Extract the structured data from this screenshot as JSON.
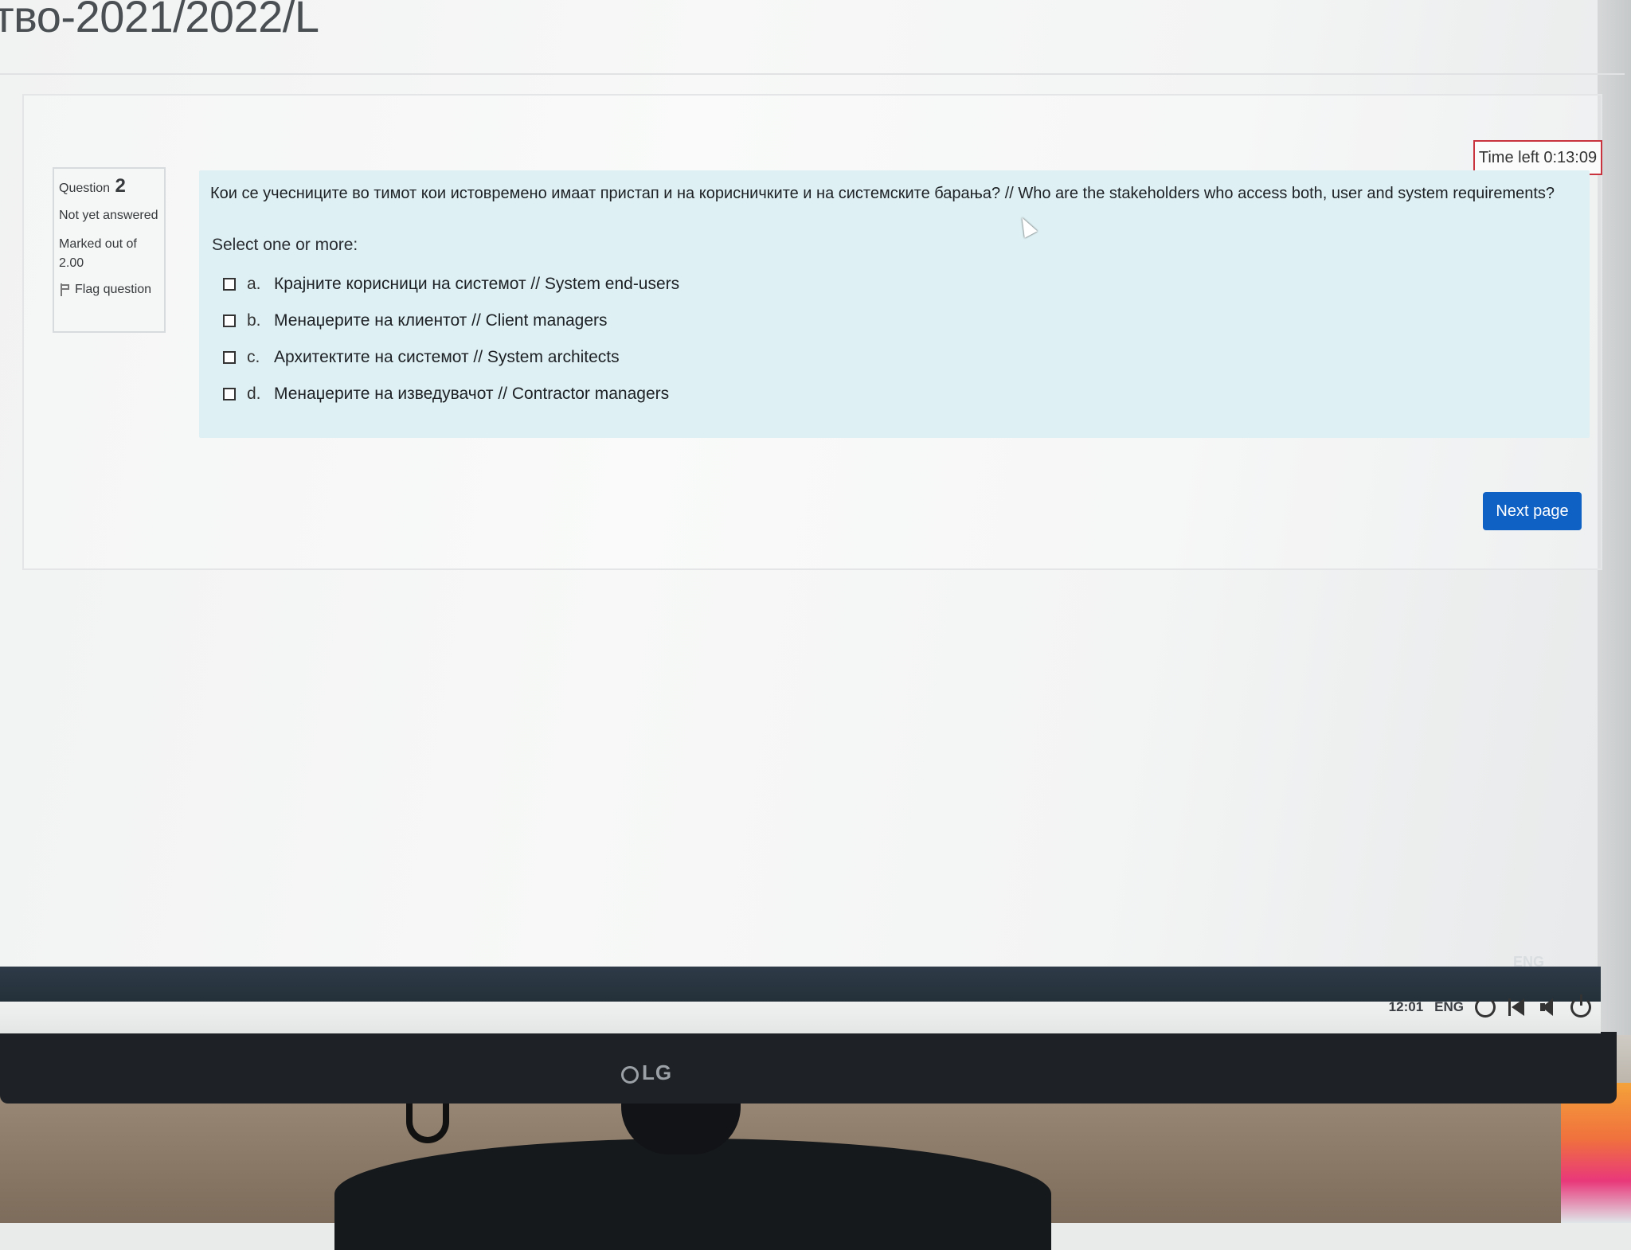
{
  "page": {
    "course_title": "тво-2021/2022/L"
  },
  "timer": {
    "label": "Time left 0:13:09"
  },
  "question_info": {
    "label": "Question",
    "number": "2",
    "state": "Not yet answered",
    "marked": "Marked out of 2.00",
    "flag_label": "Flag question"
  },
  "question": {
    "text": "Кои се учесниците во тимот кои истовремено имаат пристап и на корисничките и на системските барања? // Who are the stakeholders who access both, user and system requirements?",
    "prompt": "Select one or more:",
    "options": [
      {
        "letter": "a.",
        "label": "Крајните корисници на системот // System end-users"
      },
      {
        "letter": "b.",
        "label": "Менаџерите на клиентот // Client managers"
      },
      {
        "letter": "c.",
        "label": "Архитектите на системот // System architects"
      },
      {
        "letter": "d.",
        "label": "Менаџерите на изведувачот // Contractor managers"
      }
    ]
  },
  "navigation": {
    "next_label": "Next page"
  },
  "taskbar": {
    "ghost_lang": "ENG",
    "clock": "12:01",
    "lang": "ENG",
    "icons": [
      "refresh-icon",
      "back-icon",
      "volume-icon",
      "power-icon"
    ]
  },
  "monitor": {
    "brand": "LG"
  },
  "colors": {
    "accent": "#1061c4",
    "panel": "#def0f3",
    "timer_border": "#c9333e"
  }
}
